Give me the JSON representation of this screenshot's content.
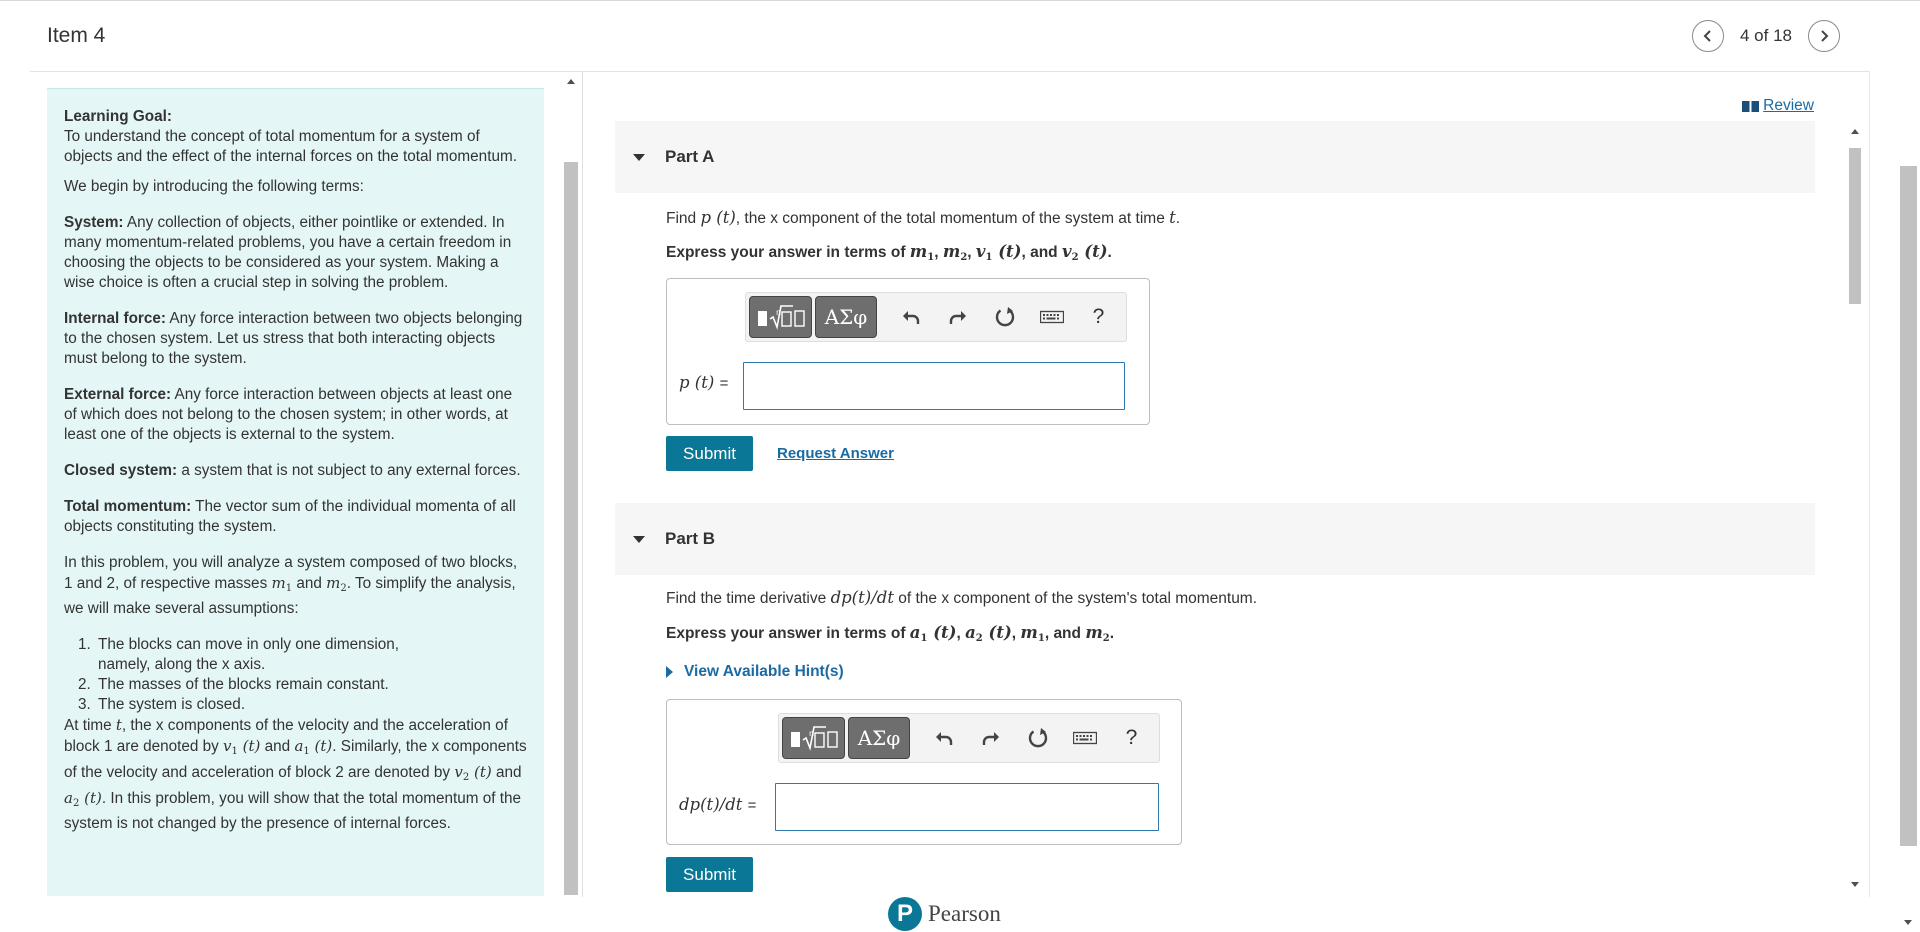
{
  "header": {
    "item_title": "Item 4",
    "pager_text": "4 of 18",
    "prev_icon": "chevron-left-icon",
    "next_icon": "chevron-right-icon"
  },
  "left_panel": {
    "learning_goal_label": "Learning Goal:",
    "learning_goal_text": "To understand the concept of total momentum for a system of objects and the effect of the internal forces on the total momentum.",
    "intro": "We begin by introducing the following terms:",
    "terms": [
      {
        "term": "System:",
        "definition": "Any collection of objects, either pointlike or extended. In many momentum-related problems, you have a certain freedom in choosing the objects to be considered as your system. Making a wise choice is often a crucial step in solving the problem."
      },
      {
        "term": "Internal force:",
        "definition": "Any force interaction between two objects belonging to the chosen system. Let us stress that both interacting objects must belong to the system."
      },
      {
        "term": "External force:",
        "definition": "Any force interaction between objects at least one of which does not belong to the chosen system; in other words, at least one of the objects is external to the system."
      },
      {
        "term": "Closed system:",
        "definition": "a system that is not subject to any external forces."
      },
      {
        "term": "Total momentum:",
        "definition": "The vector sum of the individual momenta of all objects constituting the system."
      }
    ],
    "problem": {
      "p1": "In this problem, you will analyze a system composed of two blocks, 1 and 2, of respective masses",
      "and": "and",
      "p2": ". To simplify the analysis, we will make several assumptions:"
    },
    "assumptions": [
      "The blocks can move in only one dimension, namely, along the x axis.",
      "The masses of the blocks remain constant.",
      "The system is closed."
    ],
    "closing": {
      "at_time": "At time",
      "c1": ", the x components of the velocity and the acceleration of block 1 are denoted by",
      "and": "and",
      "c2": ". Similarly, the x components of the velocity and acceleration of block 2 are denoted by",
      "c3": ". In this problem, you will show that the total momentum of the system is not changed by the presence of internal forces."
    }
  },
  "review": {
    "label": "Review",
    "icon": "book-icon"
  },
  "part_a": {
    "title": "Part A",
    "find_pre": "Find",
    "find_post": ", the x component of the total momentum of the system at time",
    "express_pre": "Express your answer in terms of",
    "express_sep": ",",
    "express_and": ", and",
    "var_label": "p (t)",
    "equals": "=",
    "input_value": "",
    "submit": "Submit",
    "request_answer": "Request Answer"
  },
  "part_b": {
    "title": "Part B",
    "find_pre": "Find the time derivative",
    "find_post": "of the x component of the system's total momentum.",
    "express_pre": "Express your answer in terms of",
    "express_and": ", and",
    "hint": "View Available Hint(s)",
    "var_label": "dp(t)/dt",
    "equals": "=",
    "input_value": "",
    "submit": "Submit"
  },
  "toolbar": {
    "greek": "ΑΣφ",
    "help": "?",
    "icons": [
      "templates-icon",
      "greek-symbols-icon",
      "undo-icon",
      "redo-icon",
      "reset-icon",
      "keyboard-icon",
      "help-icon"
    ]
  },
  "math": {
    "m": "m",
    "v": "v",
    "a": "a",
    "t": "t",
    "p_t": "p (t)",
    "dpdt": "dp(t)/dt",
    "one": "1",
    "two": "2",
    "paren_t": "(t)"
  },
  "brand": {
    "letter": "P",
    "name": "Pearson"
  },
  "colors": {
    "accent": "#0b7796",
    "link": "#1a6aa4",
    "panel_bg": "#e5f6f6",
    "input_border": "#2c7aaf"
  }
}
